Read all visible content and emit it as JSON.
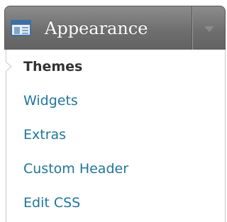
{
  "menu": {
    "title": "Appearance",
    "icon": "appearance-icon",
    "toggle_icon": "chevron-down-icon",
    "header_color": "#6f6f6f",
    "link_color": "#21759b",
    "current_color": "#333333",
    "items": [
      {
        "label": "Themes",
        "current": true
      },
      {
        "label": "Widgets",
        "current": false
      },
      {
        "label": "Extras",
        "current": false
      },
      {
        "label": "Custom Header",
        "current": false
      },
      {
        "label": "Edit CSS",
        "current": false
      }
    ]
  }
}
